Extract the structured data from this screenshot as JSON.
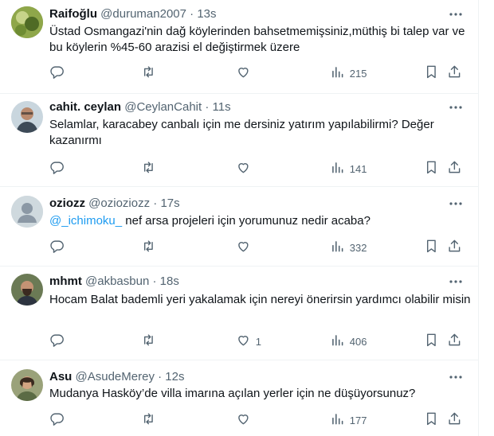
{
  "tweets": [
    {
      "name": "Raifoğlu",
      "handle": "@duruman2007",
      "time": "13s",
      "text": "Üstad Osmangazi'nin dağ köylerinden bahsetmemişsiniz,müthiş bi talep var ve bu köylerin %45-60 arazisi el değiştirmek üzere",
      "likes": "",
      "views": "215",
      "avatar": "avatar-raifoglu"
    },
    {
      "name": "cahit. ceylan",
      "handle": "@CeylanCahit",
      "time": "11s",
      "text": "Selamlar, karacabey canbalı için me dersiniz yatırım yapılabilirmi? Değer kazanırmı",
      "likes": "",
      "views": "141",
      "avatar": "avatar-cahit"
    },
    {
      "name": "oziozz",
      "handle": "@ozioziozz",
      "time": "17s",
      "mention": "@_ichimoku_",
      "text": " nef arsa projeleri için yorumunuz nedir acaba?",
      "likes": "",
      "views": "332",
      "avatar": "avatar-default"
    },
    {
      "name": "mhmt",
      "handle": "@akbasbun",
      "time": "18s",
      "text": "Hocam Balat bademli yeri yakalamak için nereyi önerirsin yardımcı olabilir misin",
      "likes": "1",
      "views": "406",
      "avatar": "avatar-mhmt"
    },
    {
      "name": "Asu",
      "handle": "@AsudeMerey",
      "time": "12s",
      "text": "Mudanya Hasköy’de villa imarına açılan yerler için ne düşüyorsunuz?",
      "likes": "",
      "views": "177",
      "avatar": "avatar-asu"
    }
  ],
  "separator": "·",
  "colors": {
    "text_primary": "#0f1419",
    "text_secondary": "#536471",
    "link": "#1d9bf0",
    "border": "#eff3f4"
  },
  "icons": [
    "reply-icon",
    "retweet-icon",
    "like-icon",
    "views-icon",
    "bookmark-icon",
    "share-icon",
    "more-icon"
  ]
}
